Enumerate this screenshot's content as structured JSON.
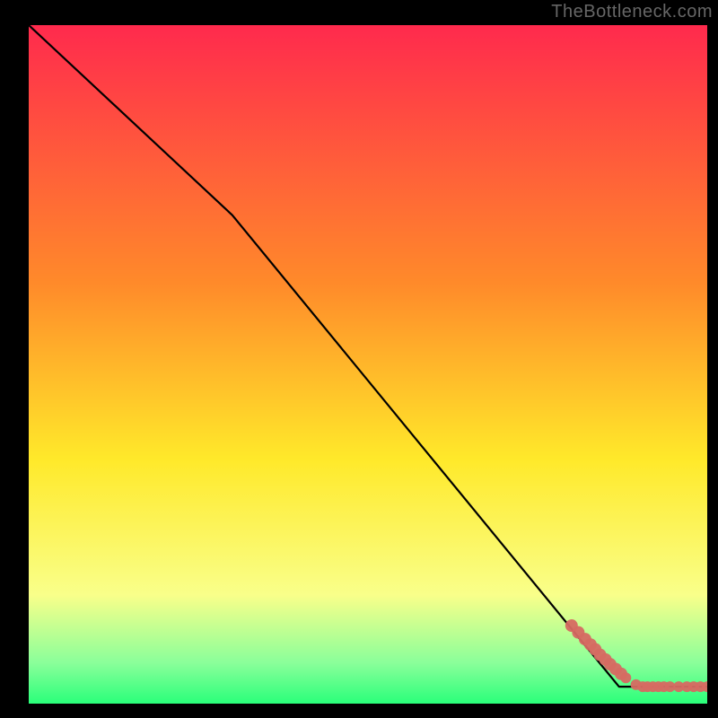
{
  "watermark": "TheBottleneck.com",
  "colors": {
    "background": "#000000",
    "line": "#000000",
    "point": "#d66a62",
    "gradient_top": "#ff2a4d",
    "gradient_mid1": "#ff8a2a",
    "gradient_mid2": "#ffe92a",
    "gradient_mid3": "#f9ff8a",
    "gradient_mid4": "#8aff9a",
    "gradient_bottom": "#2aff7a",
    "watermark": "#666666"
  },
  "chart_data": {
    "type": "line",
    "title": "",
    "xlabel": "",
    "ylabel": "",
    "xlim": [
      0,
      100
    ],
    "ylim": [
      0,
      100
    ],
    "series": [
      {
        "name": "curve",
        "x": [
          0,
          30,
          87,
          100
        ],
        "y": [
          100,
          72,
          2.5,
          2.5
        ]
      }
    ],
    "scatter": {
      "name": "points",
      "x": [
        80,
        81,
        82,
        82.8,
        83.5,
        84.2,
        85,
        85.7,
        86.5,
        87.3,
        88,
        89.5,
        90.5,
        91.2,
        92.0,
        92.8,
        93.6,
        94.5,
        95.8,
        97.0,
        98.0,
        99.0,
        100.0
      ],
      "y": [
        11.5,
        10.5,
        9.5,
        8.7,
        8.0,
        7.2,
        6.5,
        5.8,
        5.1,
        4.4,
        3.8,
        2.8,
        2.5,
        2.5,
        2.5,
        2.5,
        2.5,
        2.5,
        2.5,
        2.5,
        2.5,
        2.5,
        2.5
      ]
    }
  }
}
